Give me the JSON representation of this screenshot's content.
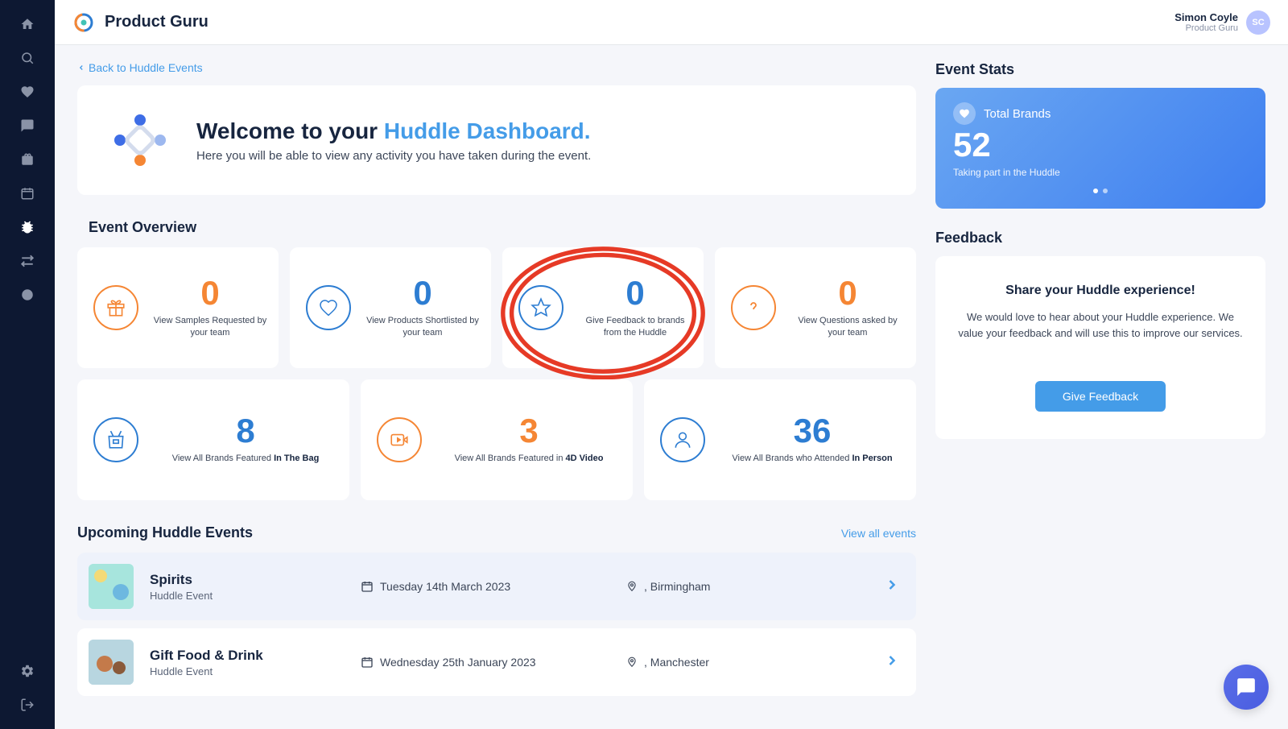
{
  "header": {
    "title": "Product Guru",
    "user_name": "Simon Coyle",
    "user_role": "Product Guru",
    "avatar_initials": "SC"
  },
  "back_link": "Back to Huddle Events",
  "welcome": {
    "title_prefix": "Welcome to your ",
    "title_highlight": "Huddle Dashboard.",
    "subtitle": "Here you will be able to view any activity you have taken during the event."
  },
  "overview": {
    "title": "Event Overview",
    "cards": [
      {
        "value": "0",
        "label": "View Samples Requested by your team",
        "color": "orange",
        "icon": "gift"
      },
      {
        "value": "0",
        "label": "View Products Shortlisted by your team",
        "color": "blue",
        "icon": "heart"
      },
      {
        "value": "0",
        "label": "Give Feedback to brands from the Huddle",
        "color": "blue",
        "icon": "star",
        "highlighted": true
      },
      {
        "value": "0",
        "label": "View Questions asked by your team",
        "color": "orange",
        "icon": "question"
      }
    ],
    "cards2": [
      {
        "value": "8",
        "label_prefix": "View All Brands Featured ",
        "label_bold": "In The Bag",
        "color": "blue",
        "icon": "bag"
      },
      {
        "value": "3",
        "label_prefix": "View All Brands Featured in ",
        "label_bold": "4D Video",
        "color": "orange",
        "icon": "video"
      },
      {
        "value": "36",
        "label_prefix": "View All Brands who Attended ",
        "label_bold": "In Person",
        "color": "blue",
        "icon": "person"
      }
    ]
  },
  "events": {
    "title": "Upcoming Huddle Events",
    "view_all": "View all events",
    "items": [
      {
        "name": "Spirits",
        "type": "Huddle Event",
        "date": "Tuesday 14th March 2023",
        "location": ", Birmingham",
        "active": true
      },
      {
        "name": "Gift Food & Drink",
        "type": "Huddle Event",
        "date": "Wednesday 25th January 2023",
        "location": ", Manchester"
      }
    ]
  },
  "stats": {
    "title": "Event Stats",
    "label": "Total Brands",
    "value": "52",
    "sub": "Taking part in the Huddle"
  },
  "feedback": {
    "section_title": "Feedback",
    "title": "Share your Huddle experience!",
    "text": "We would love to hear about your Huddle experience. We value your feedback and will use this to improve our services.",
    "button": "Give Feedback"
  }
}
